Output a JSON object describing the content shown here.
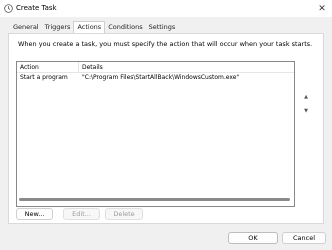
{
  "window": {
    "title": "Create Task",
    "close_glyph": "✕",
    "icon": "task-scheduler-icon"
  },
  "tabs": [
    {
      "label": "General"
    },
    {
      "label": "Triggers"
    },
    {
      "label": "Actions",
      "active": true
    },
    {
      "label": "Conditions"
    },
    {
      "label": "Settings"
    }
  ],
  "actions_tab": {
    "description": "When you create a task, you must specify the action that will occur when your task starts.",
    "table": {
      "columns": [
        "Action",
        "Details"
      ],
      "rows": [
        {
          "action": "Start a program",
          "details": "\"C:\\Program Files\\StartAllBack\\WindowsCustom.exe\""
        }
      ]
    },
    "move_up_glyph": "▲",
    "move_down_glyph": "▼",
    "buttons": {
      "new": "New...",
      "edit": "Edit...",
      "delete": "Delete"
    }
  },
  "footer": {
    "ok": "OK",
    "cancel": "Cancel"
  }
}
